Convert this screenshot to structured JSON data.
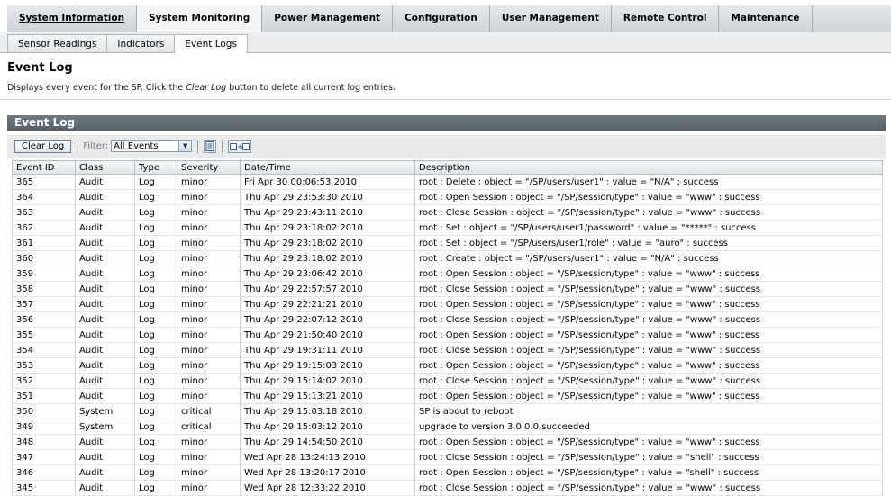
{
  "main_tabs": [
    {
      "label": "System Information",
      "state": "selected"
    },
    {
      "label": "System Monitoring",
      "state": "active"
    },
    {
      "label": "Power Management",
      "state": "normal"
    },
    {
      "label": "Configuration",
      "state": "normal"
    },
    {
      "label": "User Management",
      "state": "normal"
    },
    {
      "label": "Remote Control",
      "state": "normal"
    },
    {
      "label": "Maintenance",
      "state": "normal"
    }
  ],
  "sub_tabs": [
    {
      "label": "Sensor Readings",
      "active": false
    },
    {
      "label": "Indicators",
      "active": false
    },
    {
      "label": "Event Logs",
      "active": true
    }
  ],
  "page": {
    "title": "Event Log",
    "desc_prefix": "Displays every event for the SP. Click the ",
    "desc_em": "Clear Log",
    "desc_suffix": " button to delete all current log entries."
  },
  "panel": {
    "title": "Event Log",
    "clear_label": "Clear Log",
    "filter_label": "Filter:",
    "filter_value": "All Events",
    "icons": [
      "page-view-icon",
      "export-icon"
    ]
  },
  "table": {
    "columns": [
      "Event ID",
      "Class",
      "Type",
      "Severity",
      "Date/Time",
      "Description"
    ],
    "rows": [
      [
        "365",
        "Audit",
        "Log",
        "minor",
        "Fri Apr 30 00:06:53 2010",
        "root : Delete : object = \"/SP/users/user1\" : value = \"N/A\" : success"
      ],
      [
        "364",
        "Audit",
        "Log",
        "minor",
        "Thu Apr 29 23:53:30 2010",
        "root : Open Session : object = \"/SP/session/type\" : value = \"www\" : success"
      ],
      [
        "363",
        "Audit",
        "Log",
        "minor",
        "Thu Apr 29 23:43:11 2010",
        "root : Close Session : object = \"/SP/session/type\" : value = \"www\" : success"
      ],
      [
        "362",
        "Audit",
        "Log",
        "minor",
        "Thu Apr 29 23:18:02 2010",
        "root : Set : object = \"/SP/users/user1/password\" : value = \"*****\" : success"
      ],
      [
        "361",
        "Audit",
        "Log",
        "minor",
        "Thu Apr 29 23:18:02 2010",
        "root : Set : object = \"/SP/users/user1/role\" : value = \"auro\" : success"
      ],
      [
        "360",
        "Audit",
        "Log",
        "minor",
        "Thu Apr 29 23:18:02 2010",
        "root : Create : object = \"/SP/users/user1\" : value = \"N/A\" : success"
      ],
      [
        "359",
        "Audit",
        "Log",
        "minor",
        "Thu Apr 29 23:06:42 2010",
        "root : Open Session : object = \"/SP/session/type\" : value = \"www\" : success"
      ],
      [
        "358",
        "Audit",
        "Log",
        "minor",
        "Thu Apr 29 22:57:57 2010",
        "root : Close Session : object = \"/SP/session/type\" : value = \"www\" : success"
      ],
      [
        "357",
        "Audit",
        "Log",
        "minor",
        "Thu Apr 29 22:21:21 2010",
        "root : Open Session : object = \"/SP/session/type\" : value = \"www\" : success"
      ],
      [
        "356",
        "Audit",
        "Log",
        "minor",
        "Thu Apr 29 22:07:12 2010",
        "root : Close Session : object = \"/SP/session/type\" : value = \"www\" : success"
      ],
      [
        "355",
        "Audit",
        "Log",
        "minor",
        "Thu Apr 29 21:50:40 2010",
        "root : Open Session : object = \"/SP/session/type\" : value = \"www\" : success"
      ],
      [
        "354",
        "Audit",
        "Log",
        "minor",
        "Thu Apr 29 19:31:11 2010",
        "root : Close Session : object = \"/SP/session/type\" : value = \"www\" : success"
      ],
      [
        "353",
        "Audit",
        "Log",
        "minor",
        "Thu Apr 29 19:15:03 2010",
        "root : Open Session : object = \"/SP/session/type\" : value = \"www\" : success"
      ],
      [
        "352",
        "Audit",
        "Log",
        "minor",
        "Thu Apr 29 15:14:02 2010",
        "root : Close Session : object = \"/SP/session/type\" : value = \"www\" : success"
      ],
      [
        "351",
        "Audit",
        "Log",
        "minor",
        "Thu Apr 29 15:13:21 2010",
        "root : Open Session : object = \"/SP/session/type\" : value = \"www\" : success"
      ],
      [
        "350",
        "System",
        "Log",
        "critical",
        "Thu Apr 29 15:03:18 2010",
        "SP is about to reboot"
      ],
      [
        "349",
        "System",
        "Log",
        "critical",
        "Thu Apr 29 15:03:12 2010",
        "upgrade to version 3.0.0.0 succeeded"
      ],
      [
        "348",
        "Audit",
        "Log",
        "minor",
        "Thu Apr 29 14:54:50 2010",
        "root : Open Session : object = \"/SP/session/type\" : value = \"www\" : success"
      ],
      [
        "347",
        "Audit",
        "Log",
        "minor",
        "Wed Apr 28 13:24:13 2010",
        "root : Close Session : object = \"/SP/session/type\" : value = \"shell\" : success"
      ],
      [
        "346",
        "Audit",
        "Log",
        "minor",
        "Wed Apr 28 13:20:17 2010",
        "root : Open Session : object = \"/SP/session/type\" : value = \"shell\" : success"
      ],
      [
        "345",
        "Audit",
        "Log",
        "minor",
        "Wed Apr 28 12:33:22 2010",
        "root : Close Session : object = \"/SP/session/type\" : value = \"www\" : success"
      ]
    ]
  }
}
